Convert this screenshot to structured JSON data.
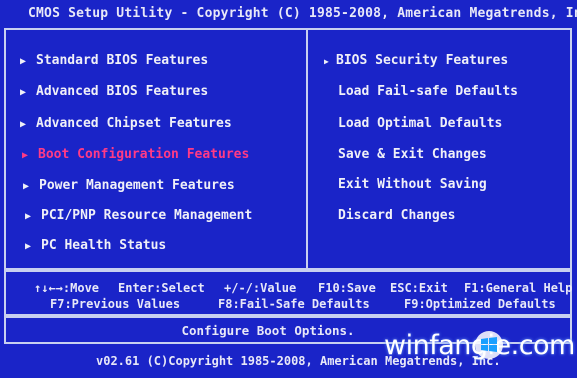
{
  "title": "CMOS Setup Utility - Copyright (C) 1985-2008, American Megatrends, Inc.",
  "left_menu": [
    {
      "label": "Standard BIOS Features"
    },
    {
      "label": "Advanced BIOS Features"
    },
    {
      "label": "Advanced Chipset Features"
    },
    {
      "label": "Boot Configuration Features",
      "selected": true
    },
    {
      "label": "Power Management Features"
    },
    {
      "label": "PCI/PNP Resource Management"
    },
    {
      "label": "PC Health Status"
    }
  ],
  "right_menu": [
    {
      "label": "BIOS Security Features"
    },
    {
      "label": "Load Fail-safe Defaults"
    },
    {
      "label": "Load Optimal Defaults"
    },
    {
      "label": "Save & Exit Changes"
    },
    {
      "label": "Exit Without Saving"
    },
    {
      "label": "Discard Changes"
    }
  ],
  "help": {
    "line1": {
      "move": "↑↓←→:Move",
      "select": "Enter:Select",
      "value": "+/-/:Value",
      "save": "F10:Save",
      "exit": "ESC:Exit",
      "general_help": "F1:General Help"
    },
    "line2": {
      "previous": "F7:Previous Values",
      "failsafe": "F8:Fail-Safe Defaults",
      "optimized": "F9:Optimized Defaults"
    }
  },
  "status": "Configure Boot Options.",
  "footer": "v02.61 (C)Copyright 1985-2008, American Megatrends, Inc.",
  "watermark": {
    "text": "winfangie.com"
  },
  "colors": {
    "background": "#1a24c8",
    "text": "#f0f0f8",
    "highlight": "#ff3a86",
    "border": "#c8d0f0"
  },
  "icons": {
    "menu_arrow": "triangle-right-icon"
  }
}
